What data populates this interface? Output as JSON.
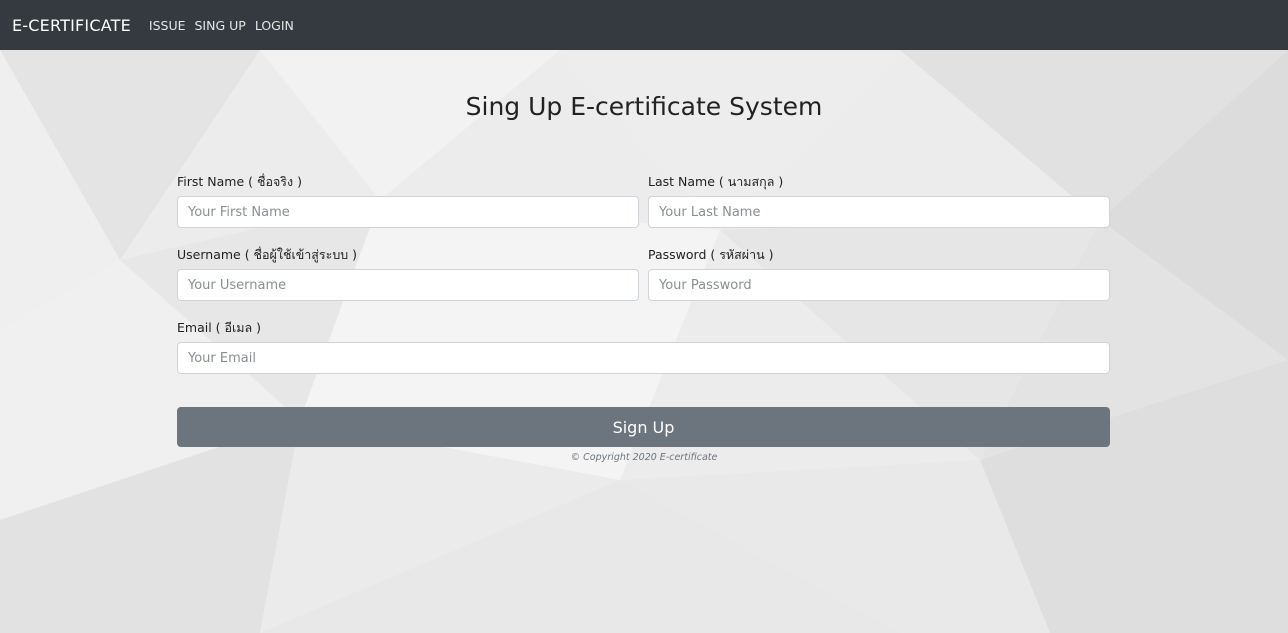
{
  "navbar": {
    "brand": "E-CERTIFICATE",
    "links": [
      "ISSUE",
      "SING UP",
      "LOGIN"
    ]
  },
  "form": {
    "title": "Sing Up E-certificate System",
    "first_name": {
      "label": "First Name ( ชื่อจริง )",
      "placeholder": "Your First Name",
      "value": ""
    },
    "last_name": {
      "label": "Last Name ( นามสกุล )",
      "placeholder": "Your Last Name",
      "value": ""
    },
    "username": {
      "label": "Username ( ชื่อผู้ใช้เข้าสู่ระบบ )",
      "placeholder": "Your Username",
      "value": ""
    },
    "password": {
      "label": "Password ( รหัสผ่าน )",
      "placeholder": "Your Password",
      "value": ""
    },
    "email": {
      "label": "Email ( อีเมล )",
      "placeholder": "Your Email",
      "value": ""
    },
    "submit_label": "Sign Up"
  },
  "footer": {
    "copyright": "© Copyright 2020 E-certificate"
  },
  "colors": {
    "navbar": "#343a40",
    "button": "#6c757d",
    "background": "#ececec"
  }
}
